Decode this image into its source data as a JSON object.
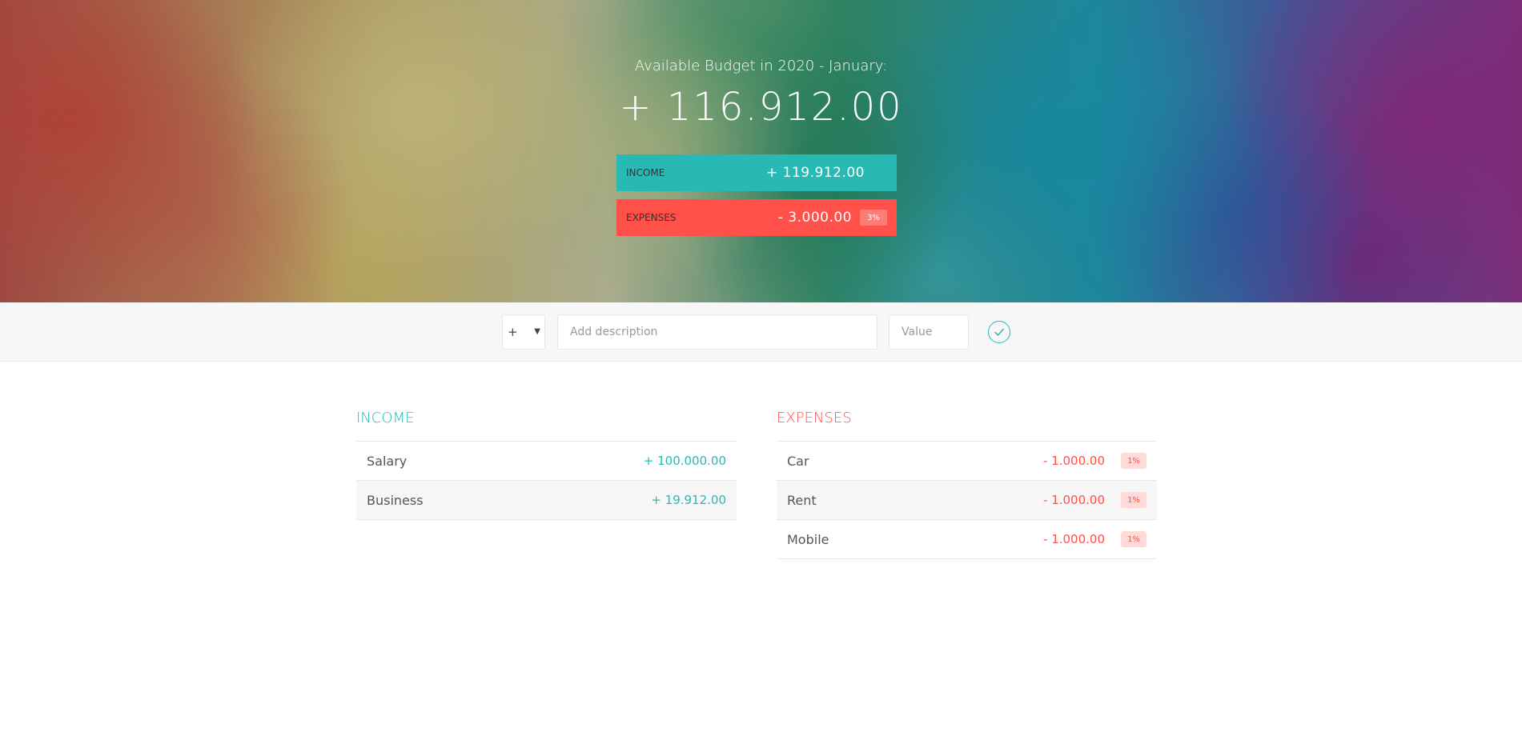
{
  "header": {
    "budget_title": "Available Budget in 2020 - January:",
    "budget_value": "+ 116.912.00",
    "income_label": "Income",
    "income_value": "+ 119.912.00",
    "expenses_label": "Expenses",
    "expenses_value": "- 3.000.00",
    "expenses_percentage": "3%"
  },
  "add_bar": {
    "type_value": "+",
    "type_options": [
      "+",
      "-"
    ],
    "description_placeholder": "Add description",
    "value_placeholder": "Value"
  },
  "income": {
    "title": "Income",
    "items": [
      {
        "description": "Salary",
        "value": "+ 100.000.00"
      },
      {
        "description": "Business",
        "value": "+ 19.912.00"
      }
    ]
  },
  "expenses": {
    "title": "Expenses",
    "items": [
      {
        "description": "Car",
        "value": "- 1.000.00",
        "percentage": "1%"
      },
      {
        "description": "Rent",
        "value": "- 1.000.00",
        "percentage": "1%"
      },
      {
        "description": "Mobile",
        "value": "- 1.000.00",
        "percentage": "1%"
      }
    ]
  },
  "colors": {
    "income": "#28b9b5",
    "expenses": "#ff5049"
  }
}
